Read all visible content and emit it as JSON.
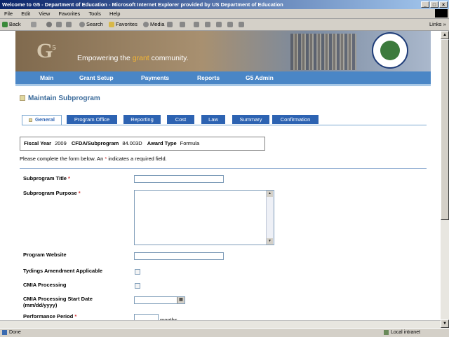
{
  "window": {
    "title": "Welcome to G5 - Department of Education - Microsoft Internet Explorer provided by US Department of Education",
    "controls": [
      "_",
      "□",
      "×"
    ]
  },
  "menu": [
    "File",
    "Edit",
    "View",
    "Favorites",
    "Tools",
    "Help"
  ],
  "toolbar": {
    "back": "Back",
    "search": "Search",
    "favorites": "Favorites",
    "media": "Media",
    "links": "Links",
    "links_arrow": "»"
  },
  "banner": {
    "logo_text": "G",
    "logo_sup": "5",
    "tagline_pre": "Empowering the ",
    "tagline_grant": "grant",
    "tagline_post": " community."
  },
  "nav": [
    "Main",
    "Grant Setup",
    "Payments",
    "Reports",
    "G5 Admin"
  ],
  "page": {
    "title": "Maintain Subprogram"
  },
  "tabs": [
    "General",
    "Program Office",
    "Reporting",
    "Cost",
    "Law",
    "Summary",
    "Confirmation"
  ],
  "info": {
    "fiscal_year_label": "Fiscal Year",
    "fiscal_year": "2009",
    "cfda_label": "CFDA/Subprogram",
    "cfda": "84.003D",
    "award_type_label": "Award Type",
    "award_type": "Formula"
  },
  "instructions": {
    "pre": "Please complete the form below. An ",
    "star": "*",
    "post": " indicates a required field."
  },
  "form": {
    "subprogram_title": "Subprogram Title",
    "subprogram_purpose": "Subprogram Purpose",
    "program_website": "Program Website",
    "tydings": "Tydings Amendment Applicable",
    "cmia": "CMIA Processing",
    "cmia_start_line1": "CMIA Processing Start Date",
    "cmia_start_line2": "(mm/dd/yyyy)",
    "performance_period": "Performance Period",
    "months": "months",
    "required_marker": "*",
    "scroll_up": "▲",
    "scroll_down": "▼",
    "calendar_glyph": "▦"
  },
  "status": {
    "left": "Done",
    "zone": "Local intranet"
  }
}
